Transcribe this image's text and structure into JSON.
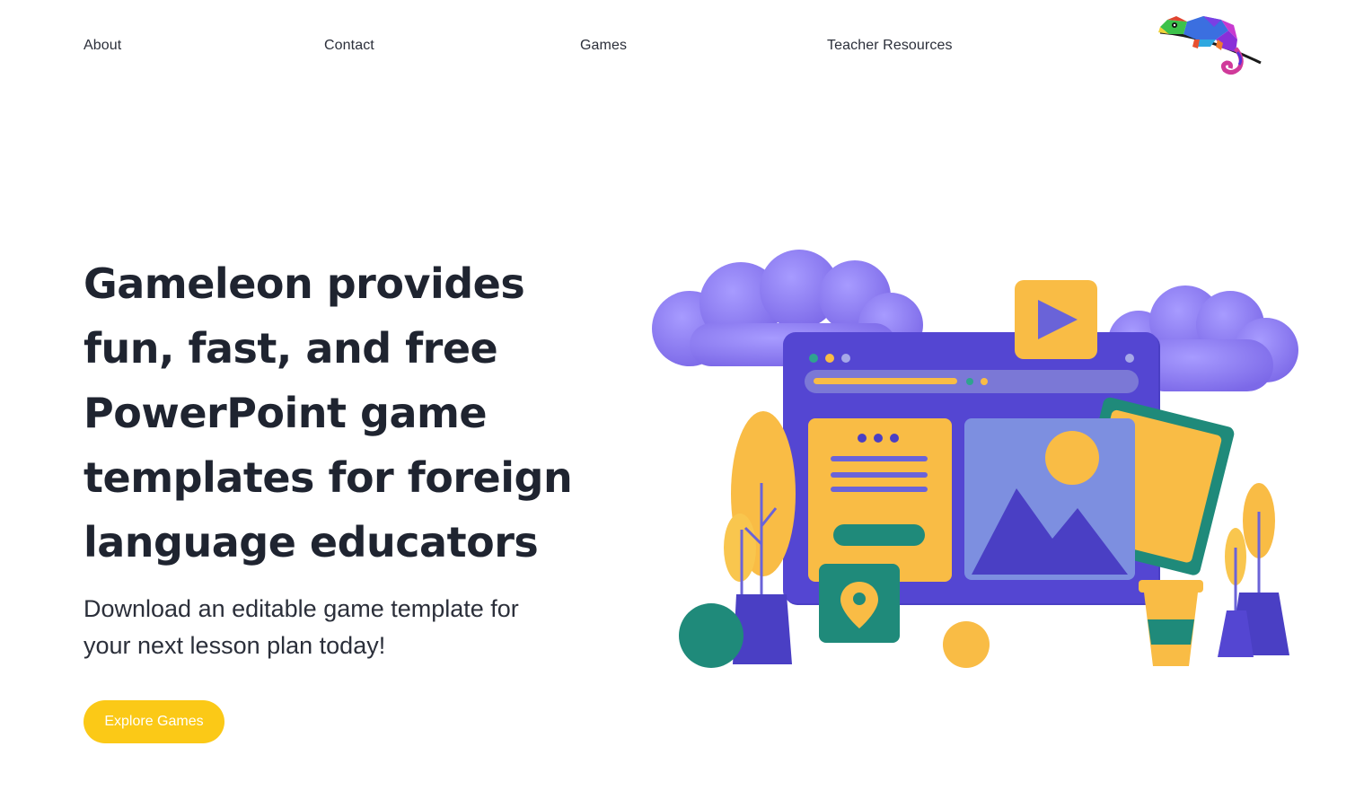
{
  "nav": {
    "about": "About",
    "contact": "Contact",
    "games": "Games",
    "teacher_resources": "Teacher Resources"
  },
  "logo": {
    "icon": "chameleon-logo-icon"
  },
  "hero": {
    "title": "Gameleon provides fun, fast, and free PowerPoint game templates for foreign language educators",
    "subtitle": "Download an editable game template for your next lesson plan today!",
    "cta_label": "Explore Games"
  },
  "illustration": {
    "icon": "web-content-illustration"
  },
  "colors": {
    "accent": "#fbc917",
    "text": "#1f2430",
    "purple": "#4a3fc4",
    "lavender": "#8b7cf0",
    "teal": "#1f8a7a",
    "yellow": "#f9bc45"
  }
}
